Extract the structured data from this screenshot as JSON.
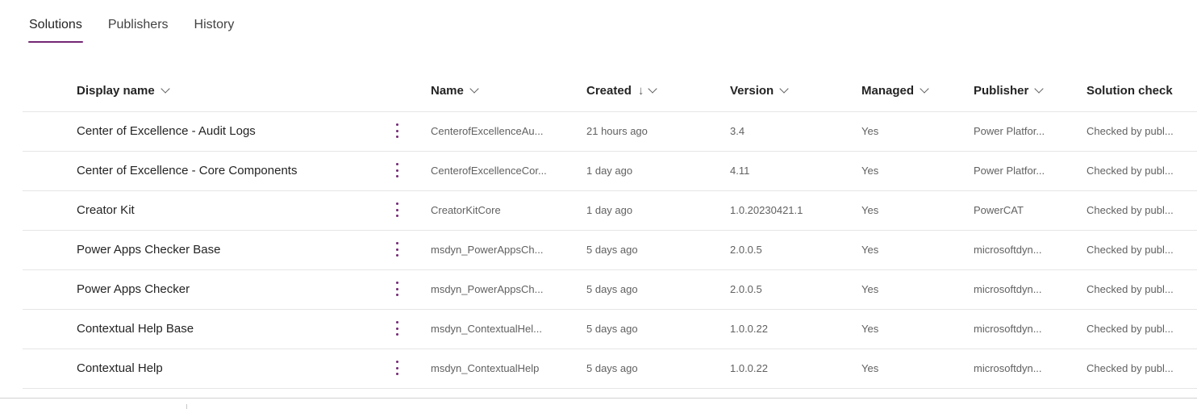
{
  "tabs": [
    {
      "label": "Solutions",
      "active": true
    },
    {
      "label": "Publishers",
      "active": false
    },
    {
      "label": "History",
      "active": false
    }
  ],
  "columns": {
    "display_name": "Display name",
    "name": "Name",
    "created": "Created",
    "created_sort_icon": "arrow-down",
    "version": "Version",
    "managed": "Managed",
    "publisher": "Publisher",
    "solution_check": "Solution check"
  },
  "rows": [
    {
      "display_name": "Center of Excellence - Audit Logs",
      "name": "CenterofExcellenceAu...",
      "created": "21 hours ago",
      "version": "3.4",
      "managed": "Yes",
      "publisher": "Power Platfor...",
      "solution_check": "Checked by publ..."
    },
    {
      "display_name": "Center of Excellence - Core Components",
      "name": "CenterofExcellenceCor...",
      "created": "1 day ago",
      "version": "4.11",
      "managed": "Yes",
      "publisher": "Power Platfor...",
      "solution_check": "Checked by publ..."
    },
    {
      "display_name": "Creator Kit",
      "name": "CreatorKitCore",
      "created": "1 day ago",
      "version": "1.0.20230421.1",
      "managed": "Yes",
      "publisher": "PowerCAT",
      "solution_check": "Checked by publ..."
    },
    {
      "display_name": "Power Apps Checker Base",
      "name": "msdyn_PowerAppsCh...",
      "created": "5 days ago",
      "version": "2.0.0.5",
      "managed": "Yes",
      "publisher": "microsoftdyn...",
      "solution_check": "Checked by publ..."
    },
    {
      "display_name": "Power Apps Checker",
      "name": "msdyn_PowerAppsCh...",
      "created": "5 days ago",
      "version": "2.0.0.5",
      "managed": "Yes",
      "publisher": "microsoftdyn...",
      "solution_check": "Checked by publ..."
    },
    {
      "display_name": "Contextual Help Base",
      "name": "msdyn_ContextualHel...",
      "created": "5 days ago",
      "version": "1.0.0.22",
      "managed": "Yes",
      "publisher": "microsoftdyn...",
      "solution_check": "Checked by publ..."
    },
    {
      "display_name": "Contextual Help",
      "name": "msdyn_ContextualHelp",
      "created": "5 days ago",
      "version": "1.0.0.22",
      "managed": "Yes",
      "publisher": "microsoftdyn...",
      "solution_check": "Checked by publ..."
    }
  ],
  "colors": {
    "accent": "#742774",
    "divider": "#e6e6e6"
  }
}
